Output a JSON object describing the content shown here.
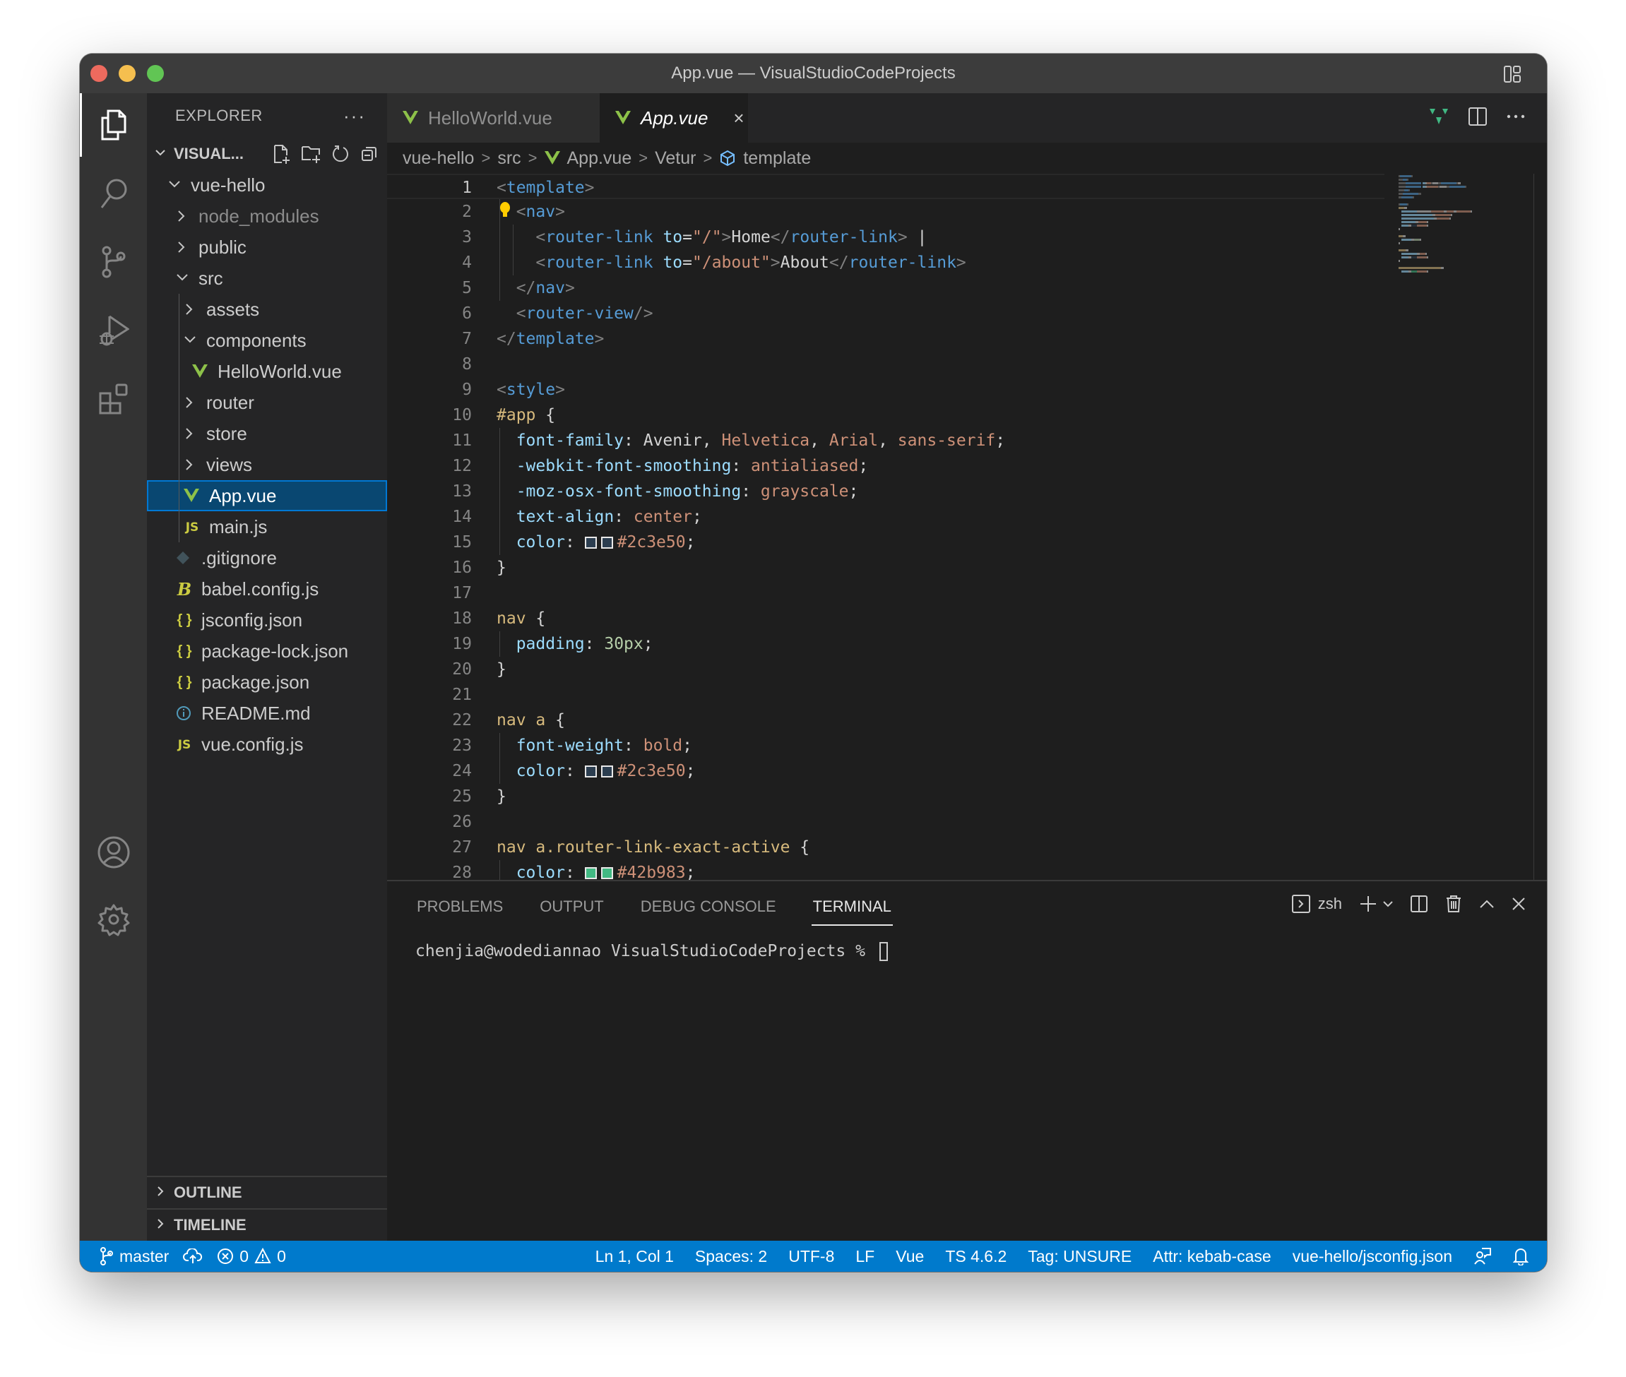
{
  "window": {
    "title": "App.vue — VisualStudioCodeProjects"
  },
  "activity_bar": {
    "items": [
      {
        "name": "explorer",
        "icon": "files-icon",
        "active": true
      },
      {
        "name": "search",
        "icon": "search-icon"
      },
      {
        "name": "source-control",
        "icon": "source-control-icon"
      },
      {
        "name": "run-debug",
        "icon": "run-debug-icon"
      },
      {
        "name": "extensions",
        "icon": "extensions-icon"
      }
    ],
    "bottom": [
      {
        "name": "accounts",
        "icon": "account-icon"
      },
      {
        "name": "manage",
        "icon": "gear-icon"
      }
    ]
  },
  "sidebar": {
    "header": "EXPLORER",
    "more": "···",
    "workspace": "VISUAL...",
    "tree": [
      {
        "label": "vue-hello",
        "type": "folder",
        "expanded": true,
        "depth": 1
      },
      {
        "label": "node_modules",
        "type": "folder",
        "expanded": false,
        "depth": 2,
        "dim": true
      },
      {
        "label": "public",
        "type": "folder",
        "expanded": false,
        "depth": 2
      },
      {
        "label": "src",
        "type": "folder",
        "expanded": true,
        "depth": 2
      },
      {
        "label": "assets",
        "type": "folder",
        "expanded": false,
        "depth": 3
      },
      {
        "label": "components",
        "type": "folder",
        "expanded": true,
        "depth": 3
      },
      {
        "label": "HelloWorld.vue",
        "type": "vue",
        "depth": 4
      },
      {
        "label": "router",
        "type": "folder",
        "expanded": false,
        "depth": 3
      },
      {
        "label": "store",
        "type": "folder",
        "expanded": false,
        "depth": 3
      },
      {
        "label": "views",
        "type": "folder",
        "expanded": false,
        "depth": 3
      },
      {
        "label": "App.vue",
        "type": "vue",
        "depth": 3,
        "selected": true
      },
      {
        "label": "main.js",
        "type": "js",
        "depth": 3
      },
      {
        "label": ".gitignore",
        "type": "git",
        "depth": 2
      },
      {
        "label": "babel.config.js",
        "type": "babel",
        "depth": 2
      },
      {
        "label": "jsconfig.json",
        "type": "json",
        "depth": 2
      },
      {
        "label": "package-lock.json",
        "type": "json",
        "depth": 2
      },
      {
        "label": "package.json",
        "type": "json",
        "depth": 2
      },
      {
        "label": "README.md",
        "type": "info",
        "depth": 2
      },
      {
        "label": "vue.config.js",
        "type": "js",
        "depth": 2
      }
    ],
    "sections": [
      "OUTLINE",
      "TIMELINE"
    ]
  },
  "editor": {
    "tabs": [
      {
        "label": "HelloWorld.vue",
        "active": false
      },
      {
        "label": "App.vue",
        "active": true,
        "close": "×"
      }
    ],
    "breadcrumb": [
      "vue-hello",
      "src",
      "App.vue",
      "Vetur",
      "template"
    ],
    "current_line": 1,
    "lines": [
      [
        [
          "t-punc",
          "<"
        ],
        [
          "t-tag",
          "template"
        ],
        [
          "t-punc",
          ">"
        ]
      ],
      [
        [
          "t-punc",
          "  <"
        ],
        [
          "t-tag",
          "nav"
        ],
        [
          "t-punc",
          ">"
        ]
      ],
      [
        [
          "t-punc",
          "    <"
        ],
        [
          "t-tag",
          "router-link"
        ],
        [
          "t-plain",
          " "
        ],
        [
          "t-attr",
          "to"
        ],
        [
          "t-plain",
          "="
        ],
        [
          "t-str",
          "\"/\""
        ],
        [
          "t-punc",
          ">"
        ],
        [
          "t-plain",
          "Home"
        ],
        [
          "t-punc",
          "</"
        ],
        [
          "t-tag",
          "router-link"
        ],
        [
          "t-punc",
          ">"
        ],
        [
          "t-plain",
          " |"
        ]
      ],
      [
        [
          "t-punc",
          "    <"
        ],
        [
          "t-tag",
          "router-link"
        ],
        [
          "t-plain",
          " "
        ],
        [
          "t-attr",
          "to"
        ],
        [
          "t-plain",
          "="
        ],
        [
          "t-str",
          "\"/about\""
        ],
        [
          "t-punc",
          ">"
        ],
        [
          "t-plain",
          "About"
        ],
        [
          "t-punc",
          "</"
        ],
        [
          "t-tag",
          "router-link"
        ],
        [
          "t-punc",
          ">"
        ]
      ],
      [
        [
          "t-punc",
          "  </"
        ],
        [
          "t-tag",
          "nav"
        ],
        [
          "t-punc",
          ">"
        ]
      ],
      [
        [
          "t-punc",
          "  <"
        ],
        [
          "t-tag",
          "router-view"
        ],
        [
          "t-punc",
          "/>"
        ]
      ],
      [
        [
          "t-punc",
          "</"
        ],
        [
          "t-tag",
          "template"
        ],
        [
          "t-punc",
          ">"
        ]
      ],
      [],
      [
        [
          "t-punc",
          "<"
        ],
        [
          "t-tag",
          "style"
        ],
        [
          "t-punc",
          ">"
        ]
      ],
      [
        [
          "t-sel",
          "#app"
        ],
        [
          "t-plain",
          " {"
        ]
      ],
      [
        [
          "t-plain",
          "  "
        ],
        [
          "t-prop",
          "font-family"
        ],
        [
          "t-plain",
          ": Avenir, "
        ],
        [
          "t-val",
          "Helvetica"
        ],
        [
          "t-plain",
          ", "
        ],
        [
          "t-val",
          "Arial"
        ],
        [
          "t-plain",
          ", "
        ],
        [
          "t-val",
          "sans-serif"
        ],
        [
          "t-plain",
          ";"
        ]
      ],
      [
        [
          "t-plain",
          "  "
        ],
        [
          "t-prop",
          "-webkit-font-smoothing"
        ],
        [
          "t-plain",
          ": "
        ],
        [
          "t-val",
          "antialiased"
        ],
        [
          "t-plain",
          ";"
        ]
      ],
      [
        [
          "t-plain",
          "  "
        ],
        [
          "t-prop",
          "-moz-osx-font-smoothing"
        ],
        [
          "t-plain",
          ": "
        ],
        [
          "t-val",
          "grayscale"
        ],
        [
          "t-plain",
          ";"
        ]
      ],
      [
        [
          "t-plain",
          "  "
        ],
        [
          "t-prop",
          "text-align"
        ],
        [
          "t-plain",
          ": "
        ],
        [
          "t-val",
          "center"
        ],
        [
          "t-plain",
          ";"
        ]
      ],
      [
        [
          "t-plain",
          "  "
        ],
        [
          "t-prop",
          "color"
        ],
        [
          "t-plain",
          ": "
        ],
        [
          "swatch",
          "#2c3e50"
        ],
        [
          "swatch",
          "#2c3e50"
        ],
        [
          "t-val",
          "#2c3e50"
        ],
        [
          "t-plain",
          ";"
        ]
      ],
      [
        [
          "t-plain",
          "}"
        ]
      ],
      [],
      [
        [
          "t-sel",
          "nav"
        ],
        [
          "t-plain",
          " {"
        ]
      ],
      [
        [
          "t-plain",
          "  "
        ],
        [
          "t-prop",
          "padding"
        ],
        [
          "t-plain",
          ": "
        ],
        [
          "t-num",
          "30px"
        ],
        [
          "t-plain",
          ";"
        ]
      ],
      [
        [
          "t-plain",
          "}"
        ]
      ],
      [],
      [
        [
          "t-sel",
          "nav a"
        ],
        [
          "t-plain",
          " {"
        ]
      ],
      [
        [
          "t-plain",
          "  "
        ],
        [
          "t-prop",
          "font-weight"
        ],
        [
          "t-plain",
          ": "
        ],
        [
          "t-val",
          "bold"
        ],
        [
          "t-plain",
          ";"
        ]
      ],
      [
        [
          "t-plain",
          "  "
        ],
        [
          "t-prop",
          "color"
        ],
        [
          "t-plain",
          ": "
        ],
        [
          "swatch",
          "#2c3e50"
        ],
        [
          "swatch",
          "#2c3e50"
        ],
        [
          "t-val",
          "#2c3e50"
        ],
        [
          "t-plain",
          ";"
        ]
      ],
      [
        [
          "t-plain",
          "}"
        ]
      ],
      [],
      [
        [
          "t-sel",
          "nav a.router-link-exact-active"
        ],
        [
          "t-plain",
          " {"
        ]
      ],
      [
        [
          "t-plain",
          "  "
        ],
        [
          "t-prop",
          "color"
        ],
        [
          "t-plain",
          ": "
        ],
        [
          "swatch",
          "#42b983"
        ],
        [
          "swatch",
          "#42b983"
        ],
        [
          "t-val",
          "#42b983"
        ],
        [
          "t-plain",
          ";"
        ]
      ]
    ]
  },
  "panel": {
    "tabs": [
      "PROBLEMS",
      "OUTPUT",
      "DEBUG CONSOLE",
      "TERMINAL"
    ],
    "active_tab": "TERMINAL",
    "shell": "zsh",
    "prompt": "chenjia@wodediannao VisualStudioCodeProjects % "
  },
  "statusbar": {
    "branch": "master",
    "errors": "0",
    "warnings": "0",
    "position": "Ln 1, Col 1",
    "spaces": "Spaces: 2",
    "encoding": "UTF-8",
    "eol": "LF",
    "language": "Vue",
    "ts_version": "TS 4.6.2",
    "tag_case": "Tag: UNSURE",
    "attr_case": "Attr: kebab-case",
    "config": "vue-hello/jsconfig.json"
  },
  "colors": {
    "accent": "#007acc",
    "vue_green": "#8dc149",
    "selection": "#094771"
  }
}
